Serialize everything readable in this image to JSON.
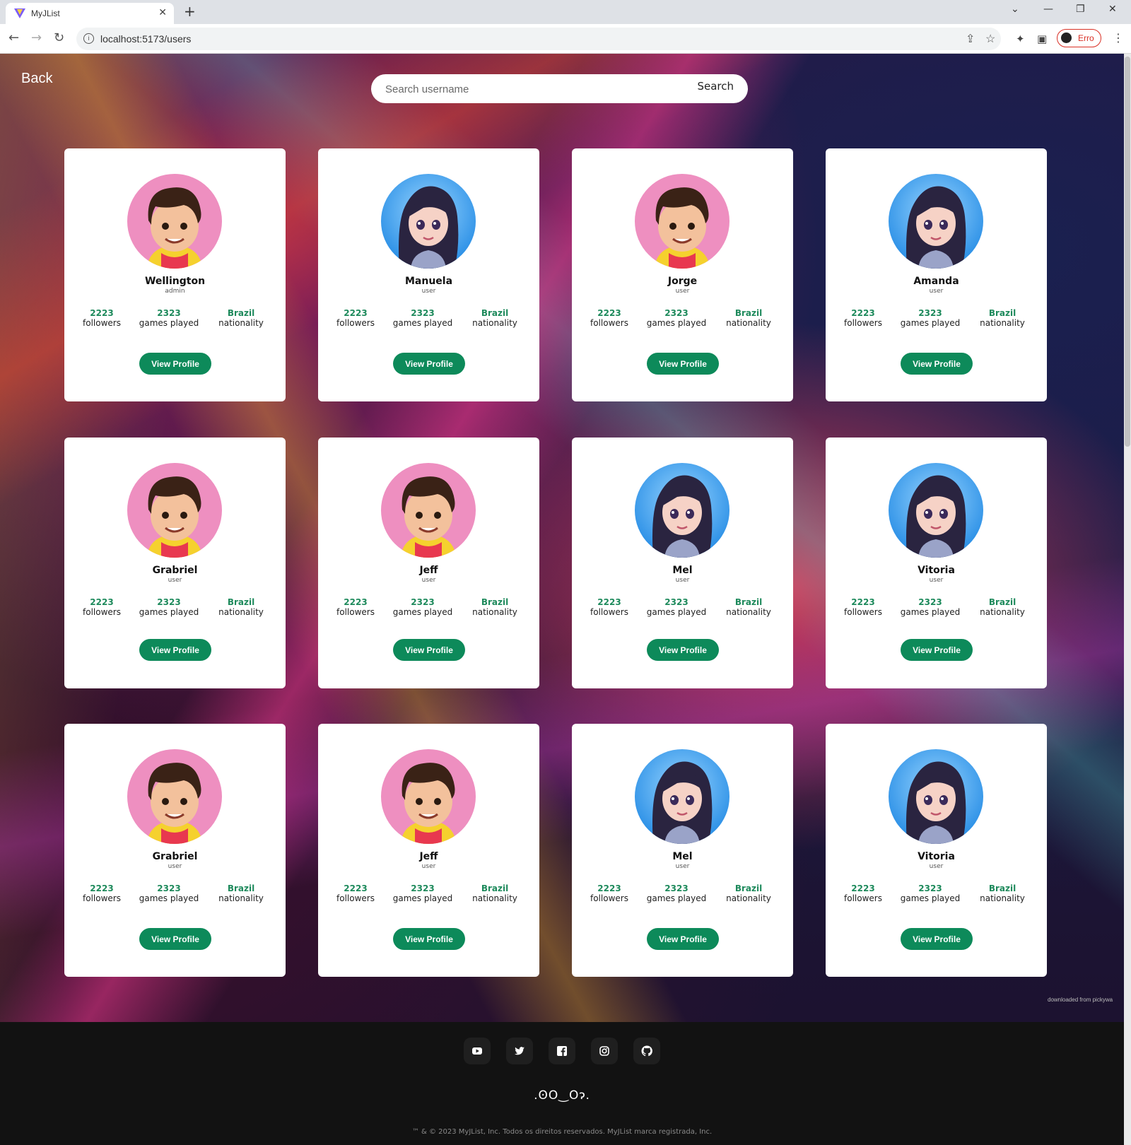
{
  "browser": {
    "tab_title": "MyJList",
    "url": "localhost:5173/users",
    "profile_label": "Erro"
  },
  "header": {
    "back_label": "Back",
    "search_placeholder": "Search username",
    "search_button": "Search"
  },
  "card_labels": {
    "followers": "followers",
    "games_played": "games played",
    "nationality": "nationality",
    "view_profile": "View Profile"
  },
  "users": [
    {
      "name": "Wellington",
      "role": "admin",
      "followers": "2223",
      "games": "2323",
      "country": "Brazil",
      "avatar": "boy-avatar"
    },
    {
      "name": "Manuela",
      "role": "user",
      "followers": "2223",
      "games": "2323",
      "country": "Brazil",
      "avatar": "girl-avatar"
    },
    {
      "name": "Jorge",
      "role": "user",
      "followers": "2223",
      "games": "2323",
      "country": "Brazil",
      "avatar": "boy-avatar"
    },
    {
      "name": "Amanda",
      "role": "user",
      "followers": "2223",
      "games": "2323",
      "country": "Brazil",
      "avatar": "girl-avatar"
    },
    {
      "name": "Grabriel",
      "role": "user",
      "followers": "2223",
      "games": "2323",
      "country": "Brazil",
      "avatar": "boy-avatar"
    },
    {
      "name": "Jeff",
      "role": "user",
      "followers": "2223",
      "games": "2323",
      "country": "Brazil",
      "avatar": "boy-avatar"
    },
    {
      "name": "Mel",
      "role": "user",
      "followers": "2223",
      "games": "2323",
      "country": "Brazil",
      "avatar": "girl-avatar"
    },
    {
      "name": "Vitoria",
      "role": "user",
      "followers": "2223",
      "games": "2323",
      "country": "Brazil",
      "avatar": "girl-avatar"
    },
    {
      "name": "Grabriel",
      "role": "user",
      "followers": "2223",
      "games": "2323",
      "country": "Brazil",
      "avatar": "boy-avatar"
    },
    {
      "name": "Jeff",
      "role": "user",
      "followers": "2223",
      "games": "2323",
      "country": "Brazil",
      "avatar": "boy-avatar"
    },
    {
      "name": "Mel",
      "role": "user",
      "followers": "2223",
      "games": "2323",
      "country": "Brazil",
      "avatar": "girl-avatar"
    },
    {
      "name": "Vitoria",
      "role": "user",
      "followers": "2223",
      "games": "2323",
      "country": "Brazil",
      "avatar": "girl-avatar"
    }
  ],
  "background_credit": "downloaded from pickywa",
  "footer": {
    "social_icons": [
      "youtube-icon",
      "twitter-icon",
      "facebook-icon",
      "instagram-icon",
      "github-icon"
    ],
    "logo": ".ꙨO‿Oɂ.",
    "copyright": "™ & © 2023 MyJList, Inc. Todos os direitos reservados. MyJList marca registrada, Inc."
  },
  "colors": {
    "accent_green": "#0d8a5a",
    "stat_green": "#1e8a5c",
    "footer_bg": "#121212",
    "card_bg": "#ffffff"
  }
}
